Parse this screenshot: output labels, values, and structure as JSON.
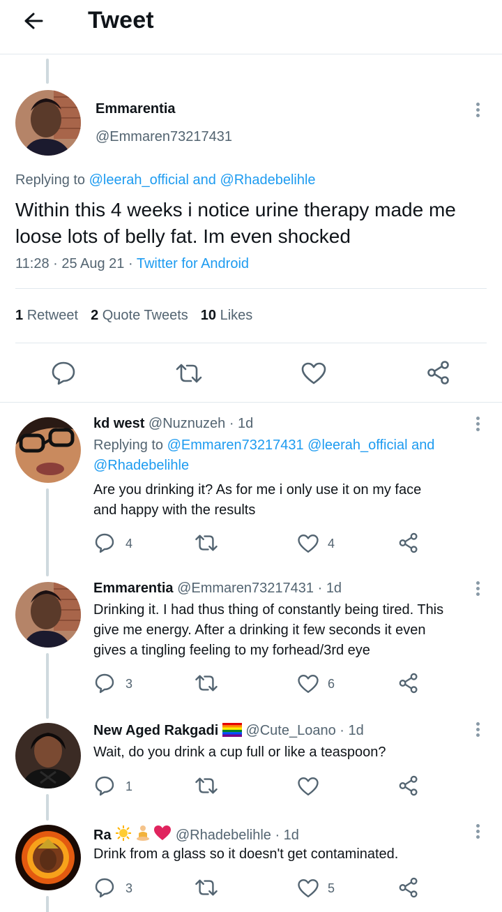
{
  "header": {
    "title": "Tweet"
  },
  "main_tweet": {
    "name": "Emmarentia",
    "handle": "@Emmaren73217431",
    "replying_prefix": "Replying to ",
    "replying_user1": "@leerah_official",
    "replying_and": " and ",
    "replying_user2": "@Rhadebelihle",
    "text": "Within this 4 weeks i notice urine therapy made me loose lots of belly fat. Im even shocked",
    "time": "11:28 · 25 Aug 21 · ",
    "source": "Twitter for Android",
    "retweets": "1",
    "retweets_label": "Retweet",
    "quotes": "2",
    "quotes_label": "Quote Tweets",
    "likes": "10",
    "likes_label": "Likes"
  },
  "replies": [
    {
      "name": "kd west",
      "handle": "@Nuznuzeh · 1d",
      "replying_prefix": "Replying to ",
      "replying_users": "@Emmaren73217431 @leerah_official and",
      "replying_users2": "@Rhadebelihle",
      "text_line1": "Are you drinking it? As for me i only use it on my face",
      "text_line2": "and happy with the results",
      "reply_count": "4",
      "like_count": "4"
    },
    {
      "name": "Emmarentia",
      "handle": "@Emmaren73217431 · 1d",
      "text_line1": "Drinking it. I had thus thing of constantly being tired. This",
      "text_line2": "give me energy. After a drinking it few seconds it even",
      "text_line3": "gives a tingling feeling to my forhead/3rd eye",
      "reply_count": "3",
      "like_count": "6"
    },
    {
      "name": "New Aged Rakgadi",
      "handle": "@Cute_Loano · 1d",
      "text_line1": "Wait, do you drink a cup full or like a teaspoon?",
      "reply_count": "1"
    },
    {
      "name": "Ra",
      "handle": "@Rhadebelihle · 1d",
      "text_line1": "Drink from a glass so it doesn't get contaminated.",
      "reply_count": "3",
      "like_count": "5"
    }
  ],
  "colors": {
    "link": "#1d9bf0",
    "secondary": "#536471",
    "thread": "#cfd9de",
    "heart_red": "#e0245e"
  }
}
